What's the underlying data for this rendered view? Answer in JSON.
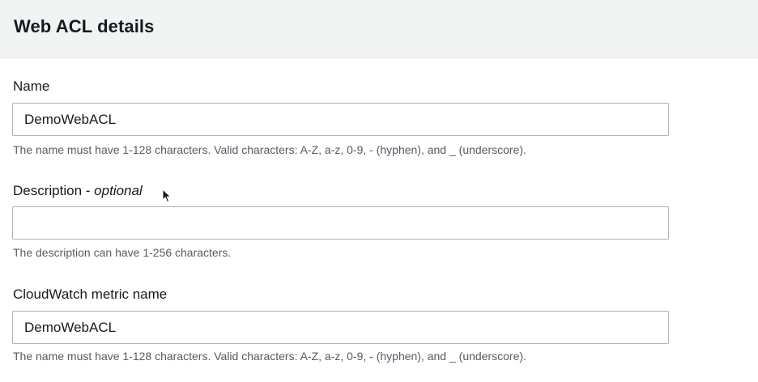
{
  "panel": {
    "title": "Web ACL details"
  },
  "fields": {
    "name": {
      "label": "Name",
      "value": "DemoWebACL",
      "hint": "The name must have 1-128 characters. Valid characters: A-Z, a-z, 0-9, - (hyphen), and _ (underscore)."
    },
    "description": {
      "label": "Description",
      "label_suffix": " - ",
      "optional": "optional",
      "value": "",
      "hint": "The description can have 1-256 characters."
    },
    "metric": {
      "label": "CloudWatch metric name",
      "value": "DemoWebACL",
      "hint": "The name must have 1-128 characters. Valid characters: A-Z, a-z, 0-9, - (hyphen), and _ (underscore)."
    }
  },
  "cursor": {
    "icon": "mouse-pointer-icon"
  }
}
